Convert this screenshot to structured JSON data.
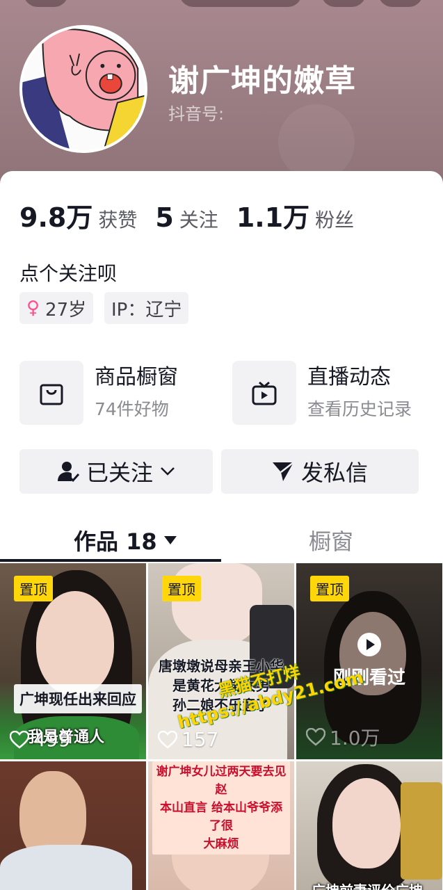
{
  "profile": {
    "nickname": "谢广坤的嫩草",
    "douyin_id_label": "抖音号:"
  },
  "stats": [
    {
      "value": "9.8万",
      "label": "获赞"
    },
    {
      "value": "5",
      "label": "关注"
    },
    {
      "value": "1.1万",
      "label": "粉丝"
    }
  ],
  "bio": "点个关注呗",
  "tags": {
    "age": "27岁",
    "ip": "IP：辽宁"
  },
  "features": {
    "shop": {
      "title": "商品橱窗",
      "subtitle": "74件好物"
    },
    "live": {
      "title": "直播动态",
      "subtitle": "查看历史记录"
    }
  },
  "actions": {
    "followed": "已关注",
    "message": "发私信"
  },
  "tabs": {
    "works": "作品 18",
    "showcase": "橱窗"
  },
  "videos": [
    {
      "pinned": "置顶",
      "likes": "499",
      "caption": "广坤现任出来回应",
      "subtitle": "我是普通人"
    },
    {
      "pinned": "置顶",
      "likes": "157",
      "caption_lines": [
        "唐墩墩说母亲王小华",
        "是黄花大闺女男",
        "孙二娘不乐意了"
      ]
    },
    {
      "pinned": "置顶",
      "likes": "1.0万",
      "seen": "刚刚看过"
    },
    {},
    {
      "caption_lines": [
        "谢广坤女儿过两天要去见赵",
        "本山直言 给本山爷爷添了很",
        "大麻烦"
      ]
    },
    {
      "caption": "广坤前妻评价广坤"
    }
  ],
  "watermark": {
    "line1": "黑猫不打烊",
    "line2": "https://abdy21.com"
  },
  "colors": {
    "accent_red": "#fe2c55",
    "pin_yellow": "#ffd60a",
    "text_primary": "#161823",
    "text_secondary": "#8a8b91"
  }
}
